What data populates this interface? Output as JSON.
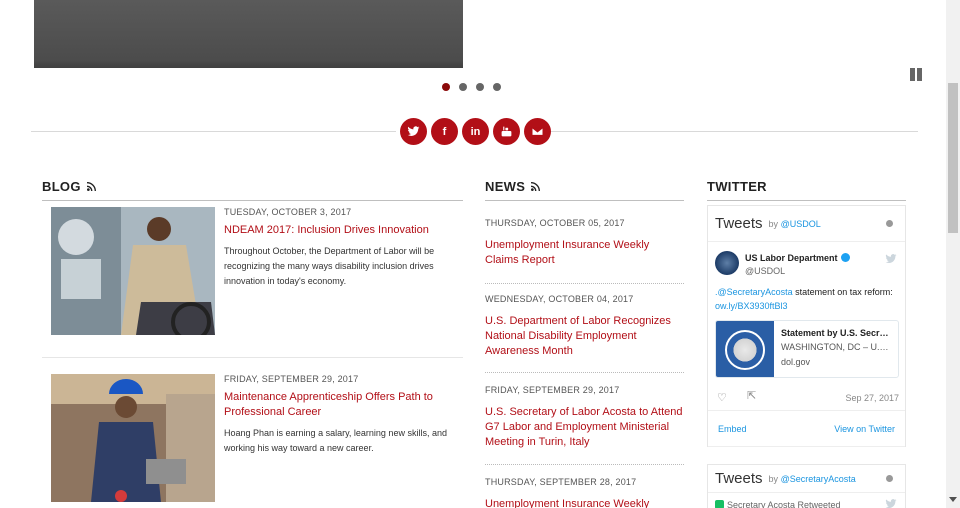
{
  "social": [
    {
      "name": "twitter",
      "glyph": ""
    },
    {
      "name": "facebook",
      "glyph": "f"
    },
    {
      "name": "linkedin",
      "glyph": "in"
    },
    {
      "name": "youtube",
      "glyph": ""
    },
    {
      "name": "email",
      "glyph": ""
    }
  ],
  "blog": {
    "heading": "BLOG",
    "items": [
      {
        "date": "TUESDAY, OCTOBER 3, 2017",
        "title": "NDEAM 2017: Inclusion Drives Innovation",
        "description": "Throughout October, the Department of Labor will be recognizing the many ways disability inclusion drives innovation in today's economy."
      },
      {
        "date": "FRIDAY, SEPTEMBER 29, 2017",
        "title": "Maintenance Apprenticeship Offers Path to Professional Career",
        "description": "Hoang Phan is earning a salary, learning new skills, and working his way toward a new career."
      }
    ]
  },
  "news": {
    "heading": "NEWS",
    "items": [
      {
        "date": "THURSDAY, OCTOBER 05, 2017",
        "title": "Unemployment Insurance Weekly Claims Report"
      },
      {
        "date": "WEDNESDAY, OCTOBER 04, 2017",
        "title": "U.S. Department of Labor Recognizes National Disability Employment Awareness Month"
      },
      {
        "date": "FRIDAY, SEPTEMBER 29, 2017",
        "title": "U.S. Secretary of Labor Acosta to Attend G7 Labor and Employment Ministerial Meeting in Turin, Italy"
      },
      {
        "date": "THURSDAY, SEPTEMBER 28, 2017",
        "title": "Unemployment Insurance Weekly Claims"
      }
    ]
  },
  "twitter": {
    "heading": "TWITTER",
    "widget1": {
      "title": "Tweets",
      "by": "by",
      "handle": "@USDOL",
      "tweet": {
        "name": "US Labor Department",
        "handle": "@USDOL",
        "mention": ".@SecretaryAcosta",
        "text": " statement on tax reform:",
        "link": "ow.ly/BX3930ftBl3",
        "card_title": "Statement by U.S. Secr…",
        "card_sub": "WASHINGTON, DC – U.…",
        "card_site": "dol.gov",
        "time": "Sep 27, 2017"
      },
      "embed": "Embed",
      "view_on": "View on Twitter"
    },
    "widget2": {
      "title": "Tweets",
      "by": "by",
      "handle": "@SecretaryAcosta",
      "retweet": "Secretary Acosta Retweeted"
    }
  },
  "colors": {
    "brand_red": "#b20f17",
    "twitter_blue": "#1b95e0"
  }
}
